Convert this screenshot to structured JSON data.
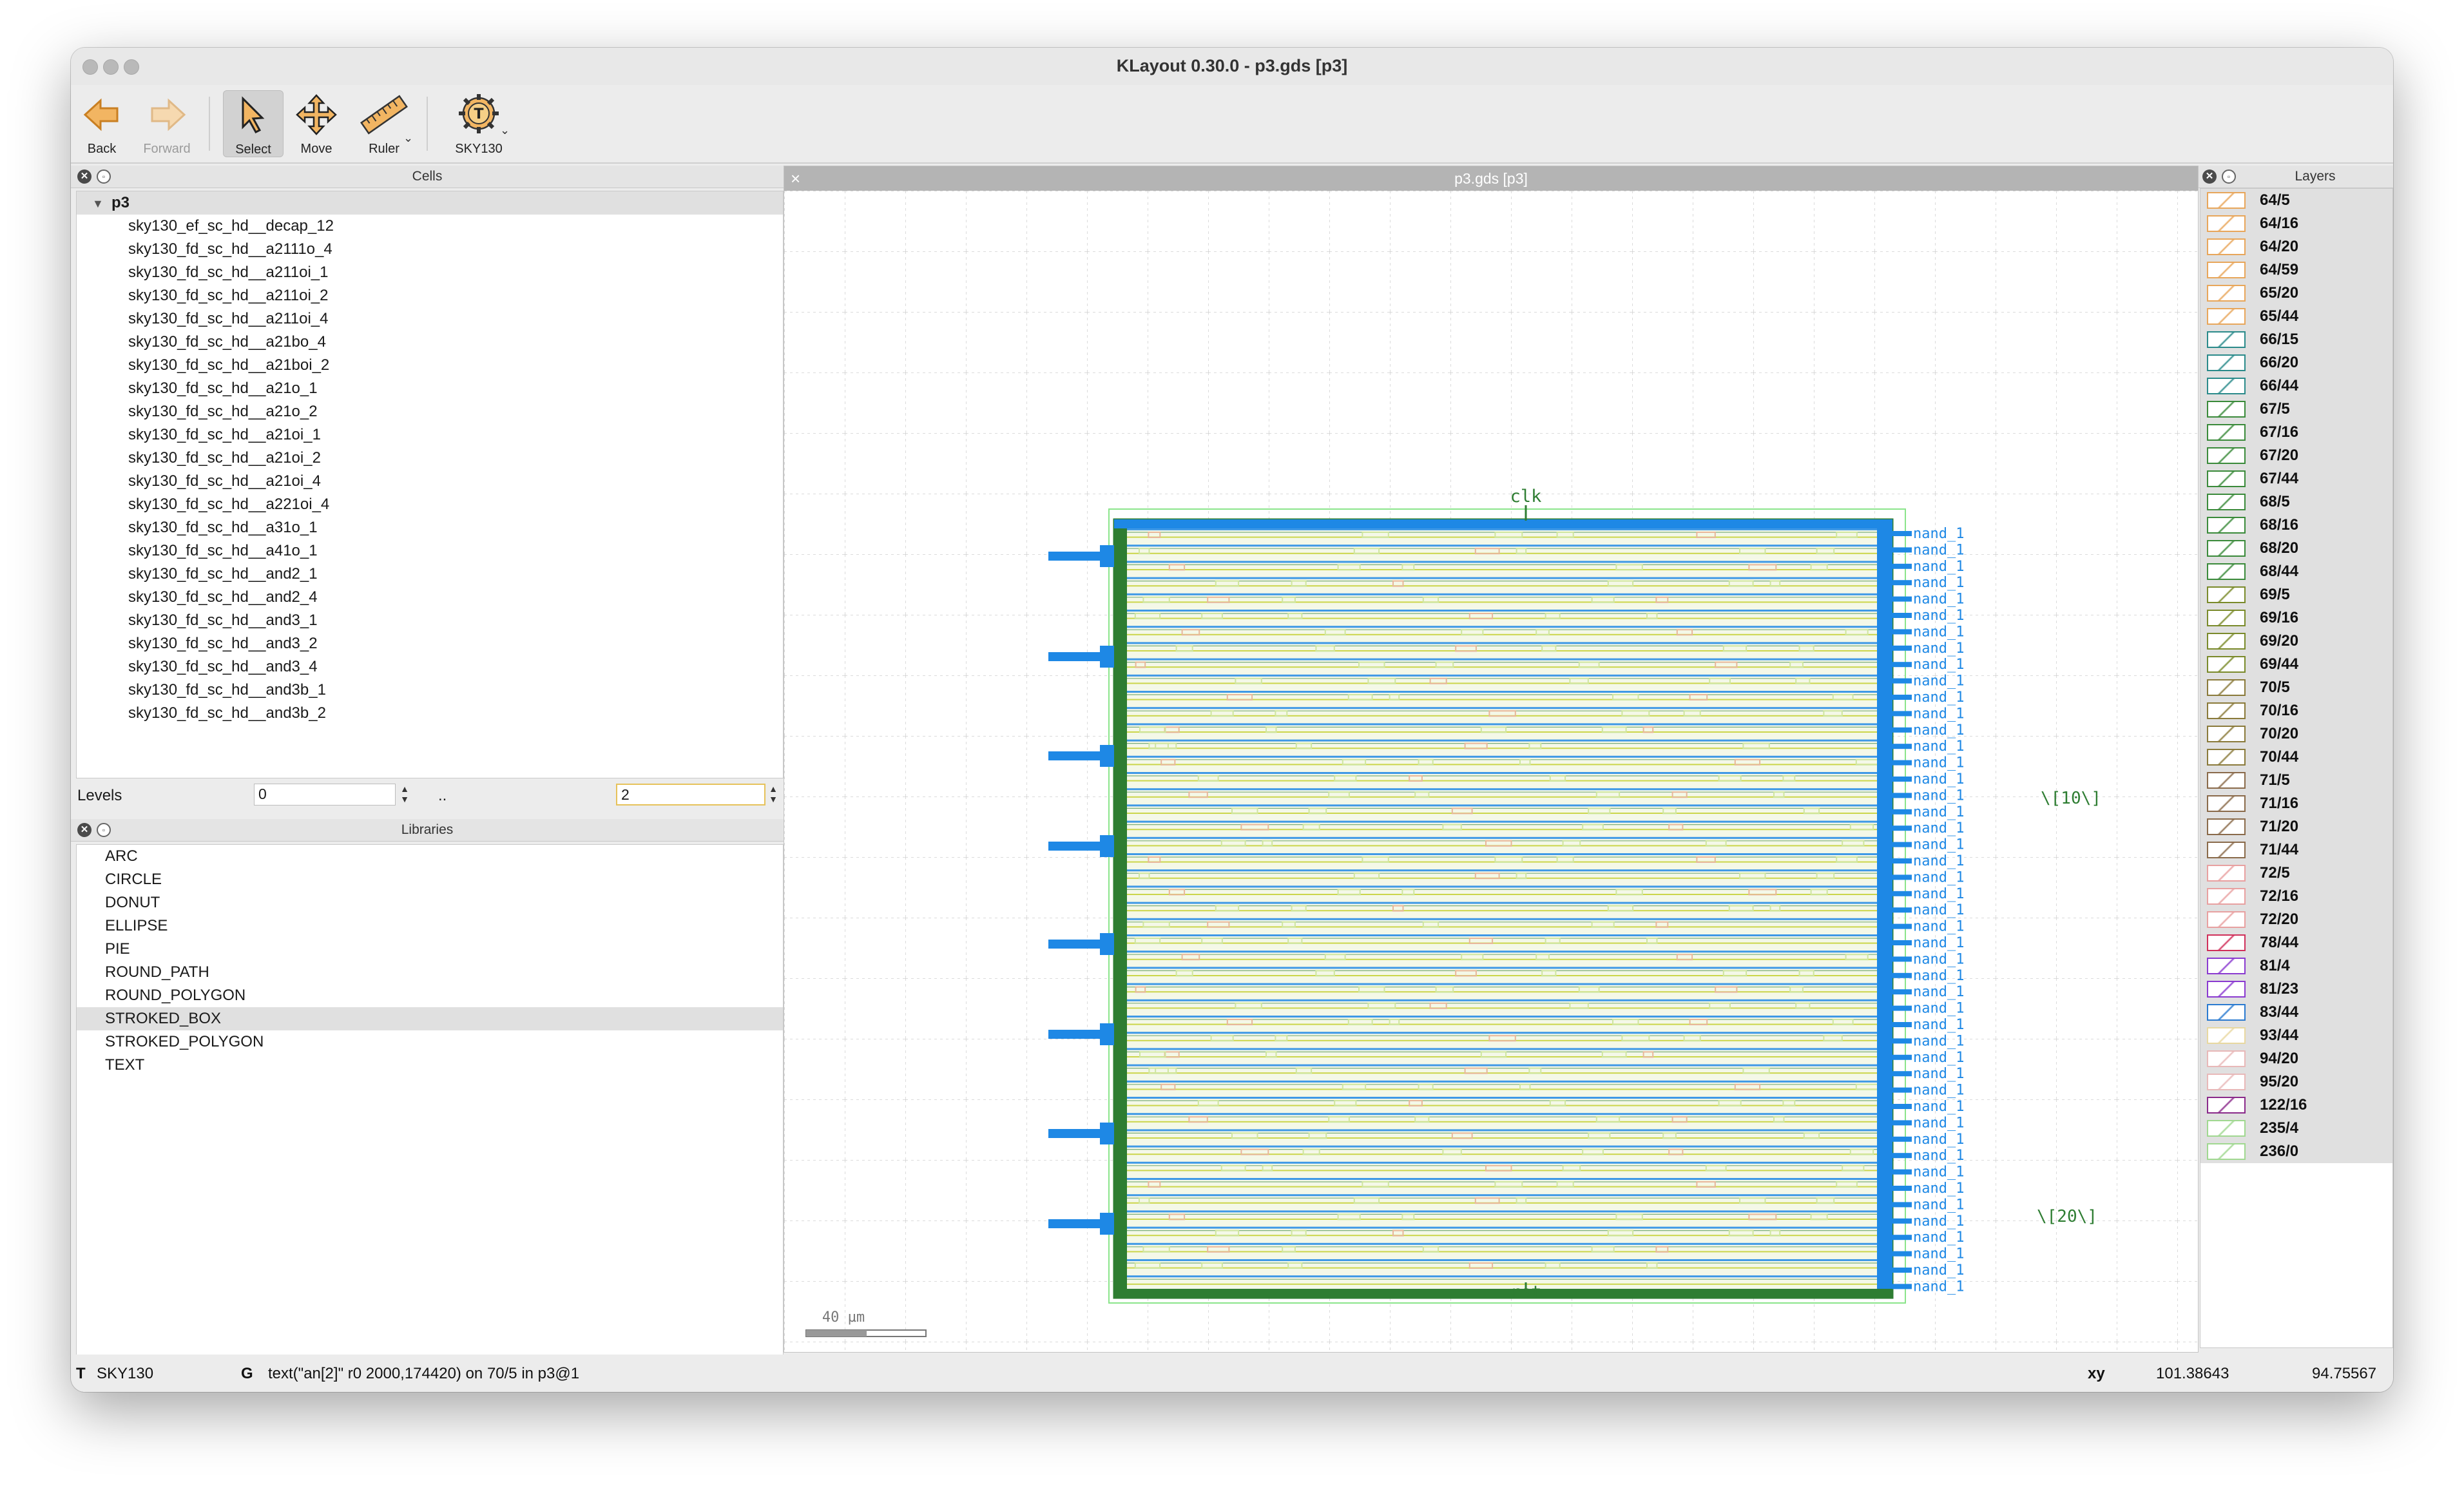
{
  "window": {
    "title": "KLayout 0.30.0 - p3.gds [p3]"
  },
  "toolbar": {
    "back": "Back",
    "forward": "Forward",
    "select": "Select",
    "move": "Move",
    "ruler": "Ruler",
    "tech": "SKY130"
  },
  "cells": {
    "title": "Cells",
    "root": "p3",
    "items": [
      "sky130_ef_sc_hd__decap_12",
      "sky130_fd_sc_hd__a2111o_4",
      "sky130_fd_sc_hd__a211oi_1",
      "sky130_fd_sc_hd__a211oi_2",
      "sky130_fd_sc_hd__a211oi_4",
      "sky130_fd_sc_hd__a21bo_4",
      "sky130_fd_sc_hd__a21boi_2",
      "sky130_fd_sc_hd__a21o_1",
      "sky130_fd_sc_hd__a21o_2",
      "sky130_fd_sc_hd__a21oi_1",
      "sky130_fd_sc_hd__a21oi_2",
      "sky130_fd_sc_hd__a21oi_4",
      "sky130_fd_sc_hd__a221oi_4",
      "sky130_fd_sc_hd__a31o_1",
      "sky130_fd_sc_hd__a41o_1",
      "sky130_fd_sc_hd__and2_1",
      "sky130_fd_sc_hd__and2_4",
      "sky130_fd_sc_hd__and3_1",
      "sky130_fd_sc_hd__and3_2",
      "sky130_fd_sc_hd__and3_4",
      "sky130_fd_sc_hd__and3b_1",
      "sky130_fd_sc_hd__and3b_2"
    ],
    "levels_label": "Levels",
    "level_min": "0",
    "level_sep": "..",
    "level_max": "2"
  },
  "libraries": {
    "title": "Libraries",
    "items": [
      "ARC",
      "CIRCLE",
      "DONUT",
      "ELLIPSE",
      "PIE",
      "ROUND_PATH",
      "ROUND_POLYGON",
      "STROKED_BOX",
      "STROKED_POLYGON",
      "TEXT"
    ],
    "selected": "STROKED_BOX"
  },
  "canvas": {
    "tab_title": "p3.gds [p3]",
    "label_clk": "clk",
    "label_rst": "rst",
    "label_bus10": "\\[10\\]",
    "label_bus20": "\\[20\\]",
    "scale_label": "40 µm",
    "pin_label": "nand_1",
    "layout_colors": {
      "metal": "#1e88e5",
      "diff": "#2e7d32",
      "poly": "#c6d23a",
      "outline": "#8be58b"
    }
  },
  "layers": {
    "title": "Layers",
    "items": [
      {
        "name": "64/5",
        "color": "#e8a65a"
      },
      {
        "name": "64/16",
        "color": "#e8a65a"
      },
      {
        "name": "64/20",
        "color": "#e8a65a"
      },
      {
        "name": "64/59",
        "color": "#e8a65a"
      },
      {
        "name": "65/20",
        "color": "#e8a65a"
      },
      {
        "name": "65/44",
        "color": "#e8a65a"
      },
      {
        "name": "66/15",
        "color": "#2a8a8a"
      },
      {
        "name": "66/20",
        "color": "#2a8a8a"
      },
      {
        "name": "66/44",
        "color": "#2a8a8a"
      },
      {
        "name": "67/5",
        "color": "#3a8a3a"
      },
      {
        "name": "67/16",
        "color": "#3a8a3a"
      },
      {
        "name": "67/20",
        "color": "#3a8a3a"
      },
      {
        "name": "67/44",
        "color": "#3a8a3a"
      },
      {
        "name": "68/5",
        "color": "#3a8a3a"
      },
      {
        "name": "68/16",
        "color": "#3a8a3a"
      },
      {
        "name": "68/20",
        "color": "#3a8a3a"
      },
      {
        "name": "68/44",
        "color": "#3a8a3a"
      },
      {
        "name": "69/5",
        "color": "#7a8a2a"
      },
      {
        "name": "69/16",
        "color": "#7a8a2a"
      },
      {
        "name": "69/20",
        "color": "#7a8a2a"
      },
      {
        "name": "69/44",
        "color": "#7a8a2a"
      },
      {
        "name": "70/5",
        "color": "#8a7a3a"
      },
      {
        "name": "70/16",
        "color": "#8a7a3a"
      },
      {
        "name": "70/20",
        "color": "#8a7a3a"
      },
      {
        "name": "70/44",
        "color": "#8a7a3a"
      },
      {
        "name": "71/5",
        "color": "#8a6a4a"
      },
      {
        "name": "71/16",
        "color": "#8a6a4a"
      },
      {
        "name": "71/20",
        "color": "#8a6a4a"
      },
      {
        "name": "71/44",
        "color": "#8a6a4a"
      },
      {
        "name": "72/5",
        "color": "#e8a0a0"
      },
      {
        "name": "72/16",
        "color": "#e8a0a0"
      },
      {
        "name": "72/20",
        "color": "#e8a0a0"
      },
      {
        "name": "78/44",
        "color": "#d0305a"
      },
      {
        "name": "81/4",
        "color": "#8a3ad0"
      },
      {
        "name": "81/23",
        "color": "#8a3ad0"
      },
      {
        "name": "83/44",
        "color": "#2a7ad0"
      },
      {
        "name": "93/44",
        "color": "#e8d8a0"
      },
      {
        "name": "94/20",
        "color": "#e8b8b8"
      },
      {
        "name": "95/20",
        "color": "#e8b8b8"
      },
      {
        "name": "122/16",
        "color": "#8a2a8a"
      },
      {
        "name": "235/4",
        "color": "#a0d890"
      },
      {
        "name": "236/0",
        "color": "#a0d890"
      }
    ]
  },
  "status": {
    "tech_key": "T",
    "tech": "SKY130",
    "grid_key": "G",
    "message": "text(\"an[2]\" r0 2000,174420) on 70/5 in p3@1",
    "coord_label": "xy",
    "x": "101.38643",
    "y": "94.75567"
  }
}
